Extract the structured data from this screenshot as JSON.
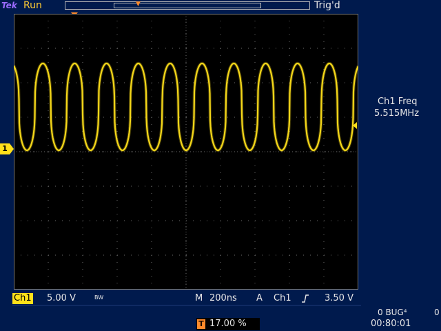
{
  "header": {
    "brand": "Tek",
    "acq_state": "Run",
    "trigger_state": "Trig'd"
  },
  "trigger_marker": {
    "label": "T",
    "icon": "trigger-position-icon"
  },
  "channel_marker": {
    "label": "1"
  },
  "measurement": {
    "label": "Ch1 Freq",
    "value": "5.515MHz"
  },
  "status_bar": {
    "channel": "Ch1",
    "volts_per_div": "5.00 V",
    "bw_limit": "BW",
    "timebase_prefix": "M",
    "time_per_div": "200ns",
    "trigger_prefix": "A",
    "trigger_source": "Ch1",
    "trigger_slope_icon": "rising-edge-icon",
    "trigger_level": "3.50 V"
  },
  "footer": {
    "bug_label": "0 BUG⁴",
    "bug_extra": "0",
    "elapsed": "00:80:01",
    "trigger_position": "17.00 %",
    "trigger_position_icon": "T"
  },
  "colors": {
    "background": "#001a4d",
    "trace": "#ffe01a",
    "trigger": "#ff8a2a",
    "grid": "#6b6b6b"
  }
}
